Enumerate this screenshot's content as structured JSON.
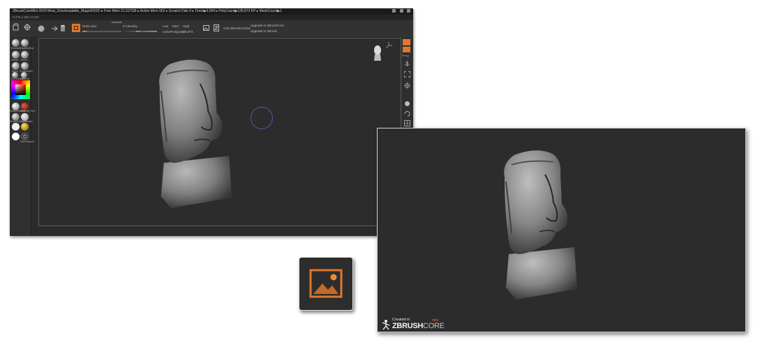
{
  "editor": {
    "title_text": "ZBrushCoreMini 2020   Moai_Downloadable_Mage3D02F   ▸ Free Mem 21.527GB ▸ Active Mem 562 ▸ Scratch Disk 0 ▸ Timer▶0.004 ▸ PolyCount▶136.873 KP ▸ MeshCount▶1",
    "coord_text": "0.475,1.852,-0.232",
    "toolbar": {
      "draw_size_label": "Draw Size",
      "draw_size_value": "Dynamic",
      "z_intensity_label": "Z Intensity",
      "low_label": "Low",
      "med_label": "Med",
      "high_label": "High",
      "active_polygons_label": "ActivePolygons",
      "active_polygons_value": "136,873",
      "visit_label": "Visit ZBrushCentral",
      "upgrade_core_label": "Upgrade to ZBrushCore",
      "upgrade_zbrush_label": "Upgrade to ZBrush"
    },
    "left_shelf": {
      "brush_labels": [
        "Standard",
        "ClayBuildup",
        "Inflate",
        "Pinch",
        "Move",
        "Snakehook",
        "TrimSmooth",
        "HPolish"
      ],
      "material_labels": [
        "BasicMaterial",
        "MatCap Red",
        "BasicMaterial2",
        "Toy Plastic",
        "White",
        "Gold",
        "",
        "SkinShade4"
      ]
    },
    "right_shelf": {
      "labels": [
        "Persp",
        "Floor",
        "Frame",
        "Move",
        "Scale",
        "Rotate"
      ]
    }
  },
  "render": {
    "watermark_created": "Created in",
    "watermark_brand_z": "ZBRUSH",
    "watermark_brand_core": "CORE",
    "watermark_mini": "mini"
  },
  "colors": {
    "accent_orange": "#e0782b",
    "viewport_bg": "#2c2c2c",
    "brush_cursor": "#6c4aa3"
  },
  "icons": {
    "render_icon": "image-render-icon"
  }
}
